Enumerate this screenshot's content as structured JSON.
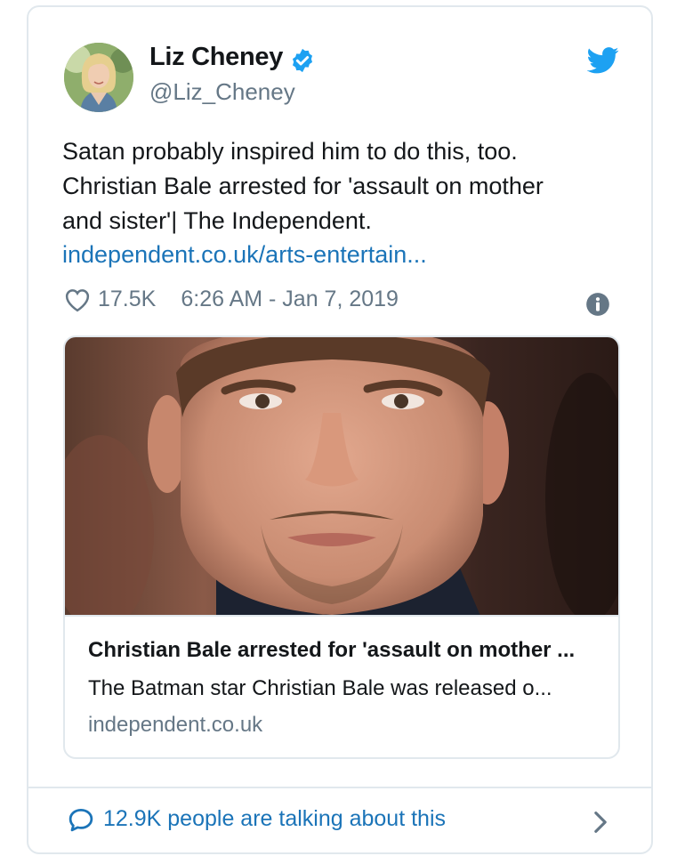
{
  "user": {
    "display_name": "Liz Cheney",
    "handle": "@Liz_Cheney",
    "verified_icon": "verified-badge-icon"
  },
  "tweet": {
    "text_lines": [
      "Satan probably inspired him to do this, too.",
      "Christian Bale arrested for 'assault on mother",
      "and sister'| The Independent."
    ],
    "link": "independent.co.uk/arts-entertain...",
    "likes": "17.5K",
    "timestamp": "6:26 AM - Jan 7, 2019"
  },
  "card": {
    "title": "Christian Bale arrested for 'assault on mother ...",
    "description": "The Batman star Christian Bale was released o...",
    "domain": "independent.co.uk"
  },
  "footer": {
    "talking_text": "12.9K people are talking about this"
  },
  "colors": {
    "link_blue": "#1b74b8",
    "twitter_blue": "#1da1f2",
    "secondary_text": "#657786",
    "border": "#e1e8ed"
  }
}
